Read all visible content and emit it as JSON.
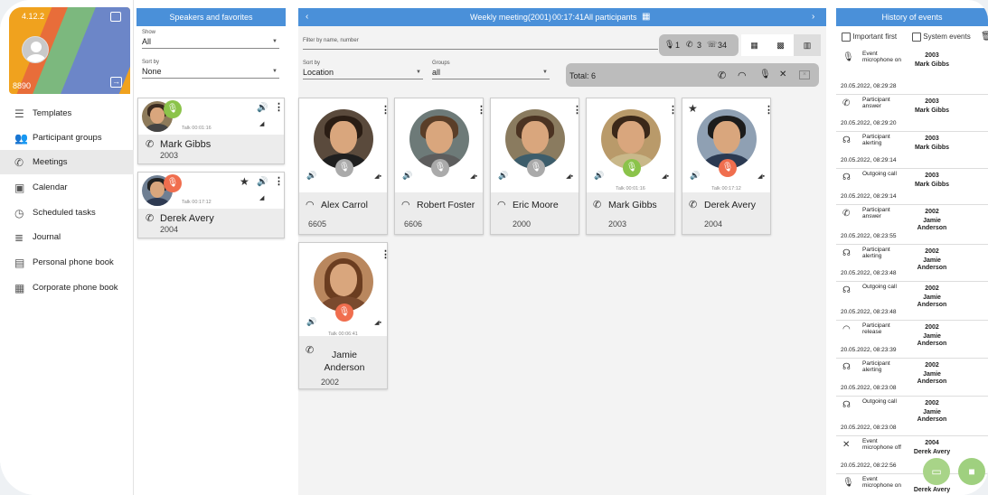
{
  "profile": {
    "version": "4.12.2",
    "extension": "8890"
  },
  "nav": {
    "items": [
      {
        "label": "Templates",
        "icon": "list-icon"
      },
      {
        "label": "Participant groups",
        "icon": "group-icon"
      },
      {
        "label": "Meetings",
        "icon": "phone-icon"
      },
      {
        "label": "Calendar",
        "icon": "calendar-icon"
      },
      {
        "label": "Scheduled tasks",
        "icon": "clock-icon"
      },
      {
        "label": "Journal",
        "icon": "journal-icon"
      },
      {
        "label": "Personal phone book",
        "icon": "contact-card-icon"
      },
      {
        "label": "Corporate phone book",
        "icon": "contact-book-icon"
      }
    ],
    "active": "Meetings"
  },
  "speakers": {
    "title": "Speakers and favorites",
    "show_label": "Show",
    "show_value": "All",
    "sort_label": "Sort by",
    "sort_value": "None",
    "cards": [
      {
        "name": "Mark Gibbs",
        "number": "2003",
        "talk": "Talk 00:01:16",
        "mic": "on",
        "favorite": false
      },
      {
        "name": "Derek Avery",
        "number": "2004",
        "talk": "Talk 00:17:12",
        "mic": "off",
        "favorite": true
      }
    ]
  },
  "meeting": {
    "title": "Weekly meeting(2001)",
    "duration": "00:17:41",
    "view": "All participants",
    "filter_label": "Filter by name, number",
    "counts": {
      "mic": "1",
      "calls": "3",
      "muted": "34"
    },
    "sort_label": "Sort by",
    "sort_value": "Location",
    "groups_label": "Groups",
    "groups_value": "all",
    "total": "Total: 6",
    "participants": [
      {
        "name": "Alex Carrol",
        "number": "6605",
        "talk": "",
        "mic": "grey",
        "state": "released"
      },
      {
        "name": "Robert Foster",
        "number": "6606",
        "talk": "",
        "mic": "grey",
        "state": "released"
      },
      {
        "name": "Eric Moore",
        "number": "2000",
        "talk": "",
        "mic": "grey",
        "state": "released"
      },
      {
        "name": "Mark Gibbs",
        "number": "2003",
        "talk": "Talk 00:01:16",
        "mic": "green",
        "state": "connected"
      },
      {
        "name": "Derek Avery",
        "number": "2004",
        "talk": "Talk 00:17:12",
        "mic": "red",
        "state": "connected"
      },
      {
        "name": "Jamie Anderson",
        "number": "2002",
        "talk": "Talk 00:06:41",
        "mic": "red",
        "state": "connected"
      }
    ]
  },
  "history": {
    "title": "History of events",
    "important_first": "Important first",
    "system_events": "System events",
    "events": [
      {
        "type": "Event microphone on",
        "date": "20.05.2022, 08:29:28",
        "number": "2003",
        "name": "Mark Gibbs",
        "icon": "mic-icon"
      },
      {
        "type": "Participant answer",
        "date": "20.05.2022, 08:29:20",
        "number": "2003",
        "name": "Mark Gibbs",
        "icon": "phone-icon"
      },
      {
        "type": "Participant alerting",
        "date": "20.05.2022, 08:29:14",
        "number": "2003",
        "name": "Mark Gibbs",
        "icon": "alerting-icon"
      },
      {
        "type": "Outgoing call",
        "date": "20.05.2022, 08:29:14",
        "number": "2003",
        "name": "Mark Gibbs",
        "icon": "alerting-icon"
      },
      {
        "type": "Participant answer",
        "date": "20.05.2022, 08:23:55",
        "number": "2002",
        "name": "Jamie Anderson",
        "icon": "phone-icon"
      },
      {
        "type": "Participant alerting",
        "date": "20.05.2022, 08:23:48",
        "number": "2002",
        "name": "Jamie Anderson",
        "icon": "alerting-icon"
      },
      {
        "type": "Outgoing call",
        "date": "20.05.2022, 08:23:48",
        "number": "2002",
        "name": "Jamie Anderson",
        "icon": "alerting-icon"
      },
      {
        "type": "Participant release",
        "date": "20.05.2022, 08:23:39",
        "number": "2002",
        "name": "Jamie Anderson",
        "icon": "hangup-icon"
      },
      {
        "type": "Participant alerting",
        "date": "20.05.2022, 08:23:08",
        "number": "2002",
        "name": "Jamie Anderson",
        "icon": "alerting-icon"
      },
      {
        "type": "Outgoing call",
        "date": "20.05.2022, 08:23:08",
        "number": "2002",
        "name": "Jamie Anderson",
        "icon": "alerting-icon"
      },
      {
        "type": "Event microphone off",
        "date": "20.05.2022, 08:22:56",
        "number": "2004",
        "name": "Derek Avery",
        "icon": "mic-off-icon"
      },
      {
        "type": "Event microphone on",
        "date": "",
        "number": "2",
        "name": "Derek Avery",
        "icon": "mic-icon"
      }
    ]
  },
  "colors": {
    "header_blue": "#4a90d9",
    "mic_green": "#8bc34a",
    "mic_red": "#f06e4e",
    "fab_green": "#9fd07f"
  }
}
